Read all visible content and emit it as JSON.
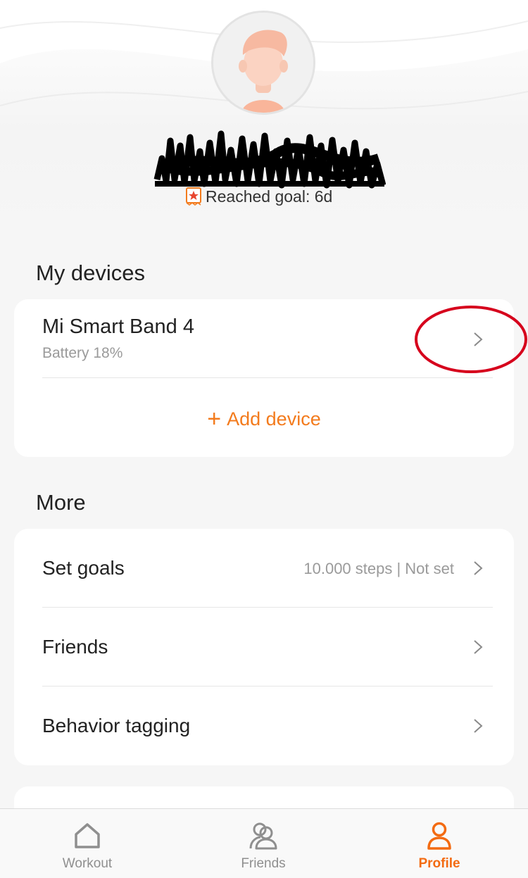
{
  "profile": {
    "goal_text": "Reached goal: 6d"
  },
  "devices_section": {
    "title": "My devices",
    "device": {
      "name": "Mi Smart Band 4",
      "battery": "Battery 18%"
    },
    "add_device_label": "Add device"
  },
  "more_section": {
    "title": "More",
    "items": [
      {
        "label": "Set goals",
        "value": "10.000 steps | Not set"
      },
      {
        "label": "Friends",
        "value": ""
      },
      {
        "label": "Behavior tagging",
        "value": ""
      }
    ]
  },
  "tabbar": {
    "tabs": [
      {
        "label": "Workout",
        "icon": "home-icon",
        "active": false
      },
      {
        "label": "Friends",
        "icon": "friends-icon",
        "active": false
      },
      {
        "label": "Profile",
        "icon": "profile-icon",
        "active": true
      }
    ]
  },
  "colors": {
    "accent": "#f37b1d",
    "annotation_circle": "#d6001c",
    "background": "#f6f6f6",
    "card": "#ffffff"
  },
  "icons": [
    "avatar-icon",
    "goal-badge-icon",
    "chevron-right-icon",
    "plus-icon",
    "home-icon",
    "friends-icon",
    "profile-icon"
  ]
}
